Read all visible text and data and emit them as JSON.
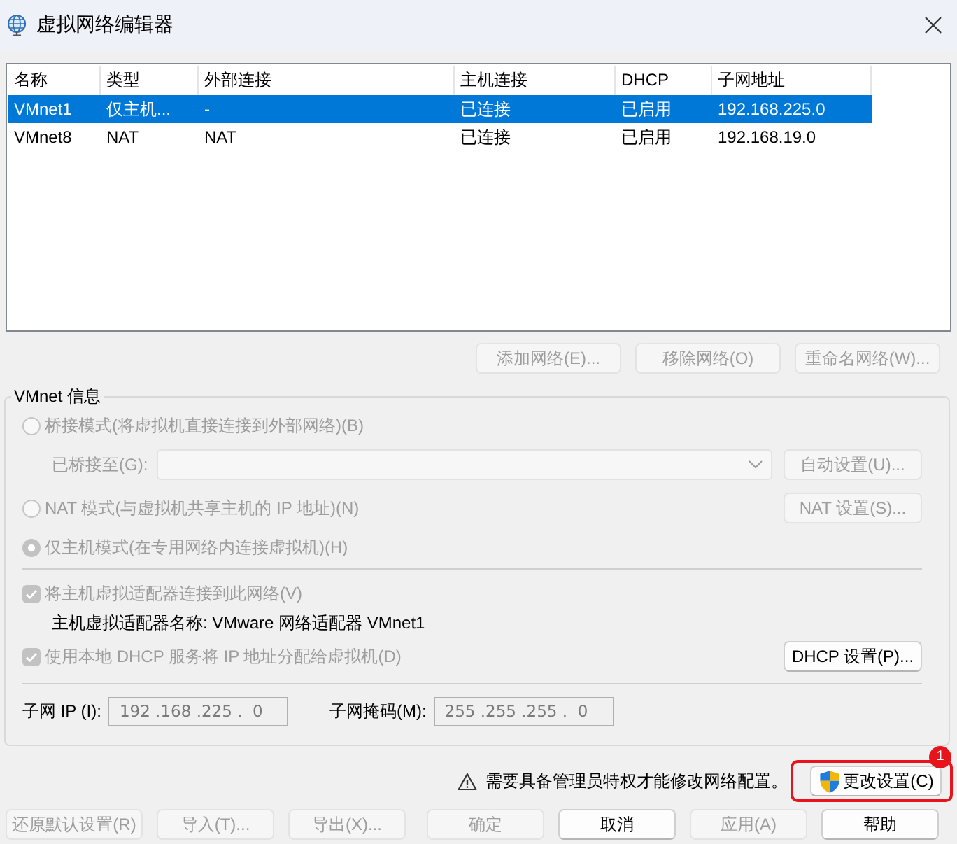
{
  "window": {
    "title": "虚拟网络编辑器"
  },
  "network_table": {
    "columns": [
      "名称",
      "类型",
      "外部连接",
      "主机连接",
      "DHCP",
      "子网地址"
    ],
    "rows": [
      {
        "cells": [
          "VMnet1",
          "仅主机...",
          "-",
          "已连接",
          "已启用",
          "192.168.225.0"
        ],
        "selected": true
      },
      {
        "cells": [
          "VMnet8",
          "NAT",
          "NAT",
          "已连接",
          "已启用",
          "192.168.19.0"
        ],
        "selected": false
      }
    ]
  },
  "network_buttons": [
    {
      "label": "添加网络(E)...",
      "disabled": true
    },
    {
      "label": "移除网络(O)",
      "disabled": true
    },
    {
      "label": "重命名网络(W)...",
      "disabled": true
    }
  ],
  "vmnet_info": {
    "title": "VMnet 信息",
    "modes": [
      {
        "label": "桥接模式(将虚拟机直接连接到外部网络)(B)",
        "selected": false,
        "disabled": true,
        "bridged_to": {
          "label": "已桥接至(G):",
          "disabled": true
        },
        "button": {
          "label": "自动设置(U)...",
          "disabled": true
        }
      },
      {
        "label": "NAT 模式(与虚拟机共享主机的 IP 地址)(N)",
        "selected": false,
        "disabled": true,
        "button": {
          "label": "NAT 设置(S)...",
          "disabled": true
        }
      },
      {
        "label": "仅主机模式(在专用网络内连接虚拟机)(H)",
        "selected": true,
        "disabled": true
      }
    ],
    "connect_adapter": {
      "label": "将主机虚拟适配器连接到此网络(V)",
      "checked": true,
      "disabled": true
    },
    "adapter_name": "主机虚拟适配器名称: VMware 网络适配器 VMnet1",
    "use_dhcp": {
      "label": "使用本地 DHCP 服务将 IP 地址分配给虚拟机(D)",
      "checked": true,
      "disabled": true,
      "button": {
        "label": "DHCP 设置(P)...",
        "disabled": false
      }
    },
    "subnet_ip": {
      "label": "子网 IP (I):",
      "value": "192 .168 .225 .  0",
      "disabled": true
    },
    "subnet_mask": {
      "label": "子网掩码(M):",
      "value": "255 .255 .255 .  0",
      "disabled": true
    }
  },
  "admin_notice": {
    "text": "需要具备管理员特权才能修改网络配置。",
    "button": {
      "label": "更改设置(C)",
      "disabled": false
    },
    "annotation_badge": "1"
  },
  "footer": {
    "left_buttons": [
      {
        "label": "还原默认设置(R)",
        "disabled": true
      },
      {
        "label": "导入(T)...",
        "disabled": true
      },
      {
        "label": "导出(X)...",
        "disabled": true
      }
    ],
    "right_buttons": [
      {
        "label": "确定",
        "disabled": true
      },
      {
        "label": "取消",
        "disabled": false
      },
      {
        "label": "应用(A)",
        "disabled": true
      },
      {
        "label": "帮助",
        "disabled": false
      }
    ]
  }
}
